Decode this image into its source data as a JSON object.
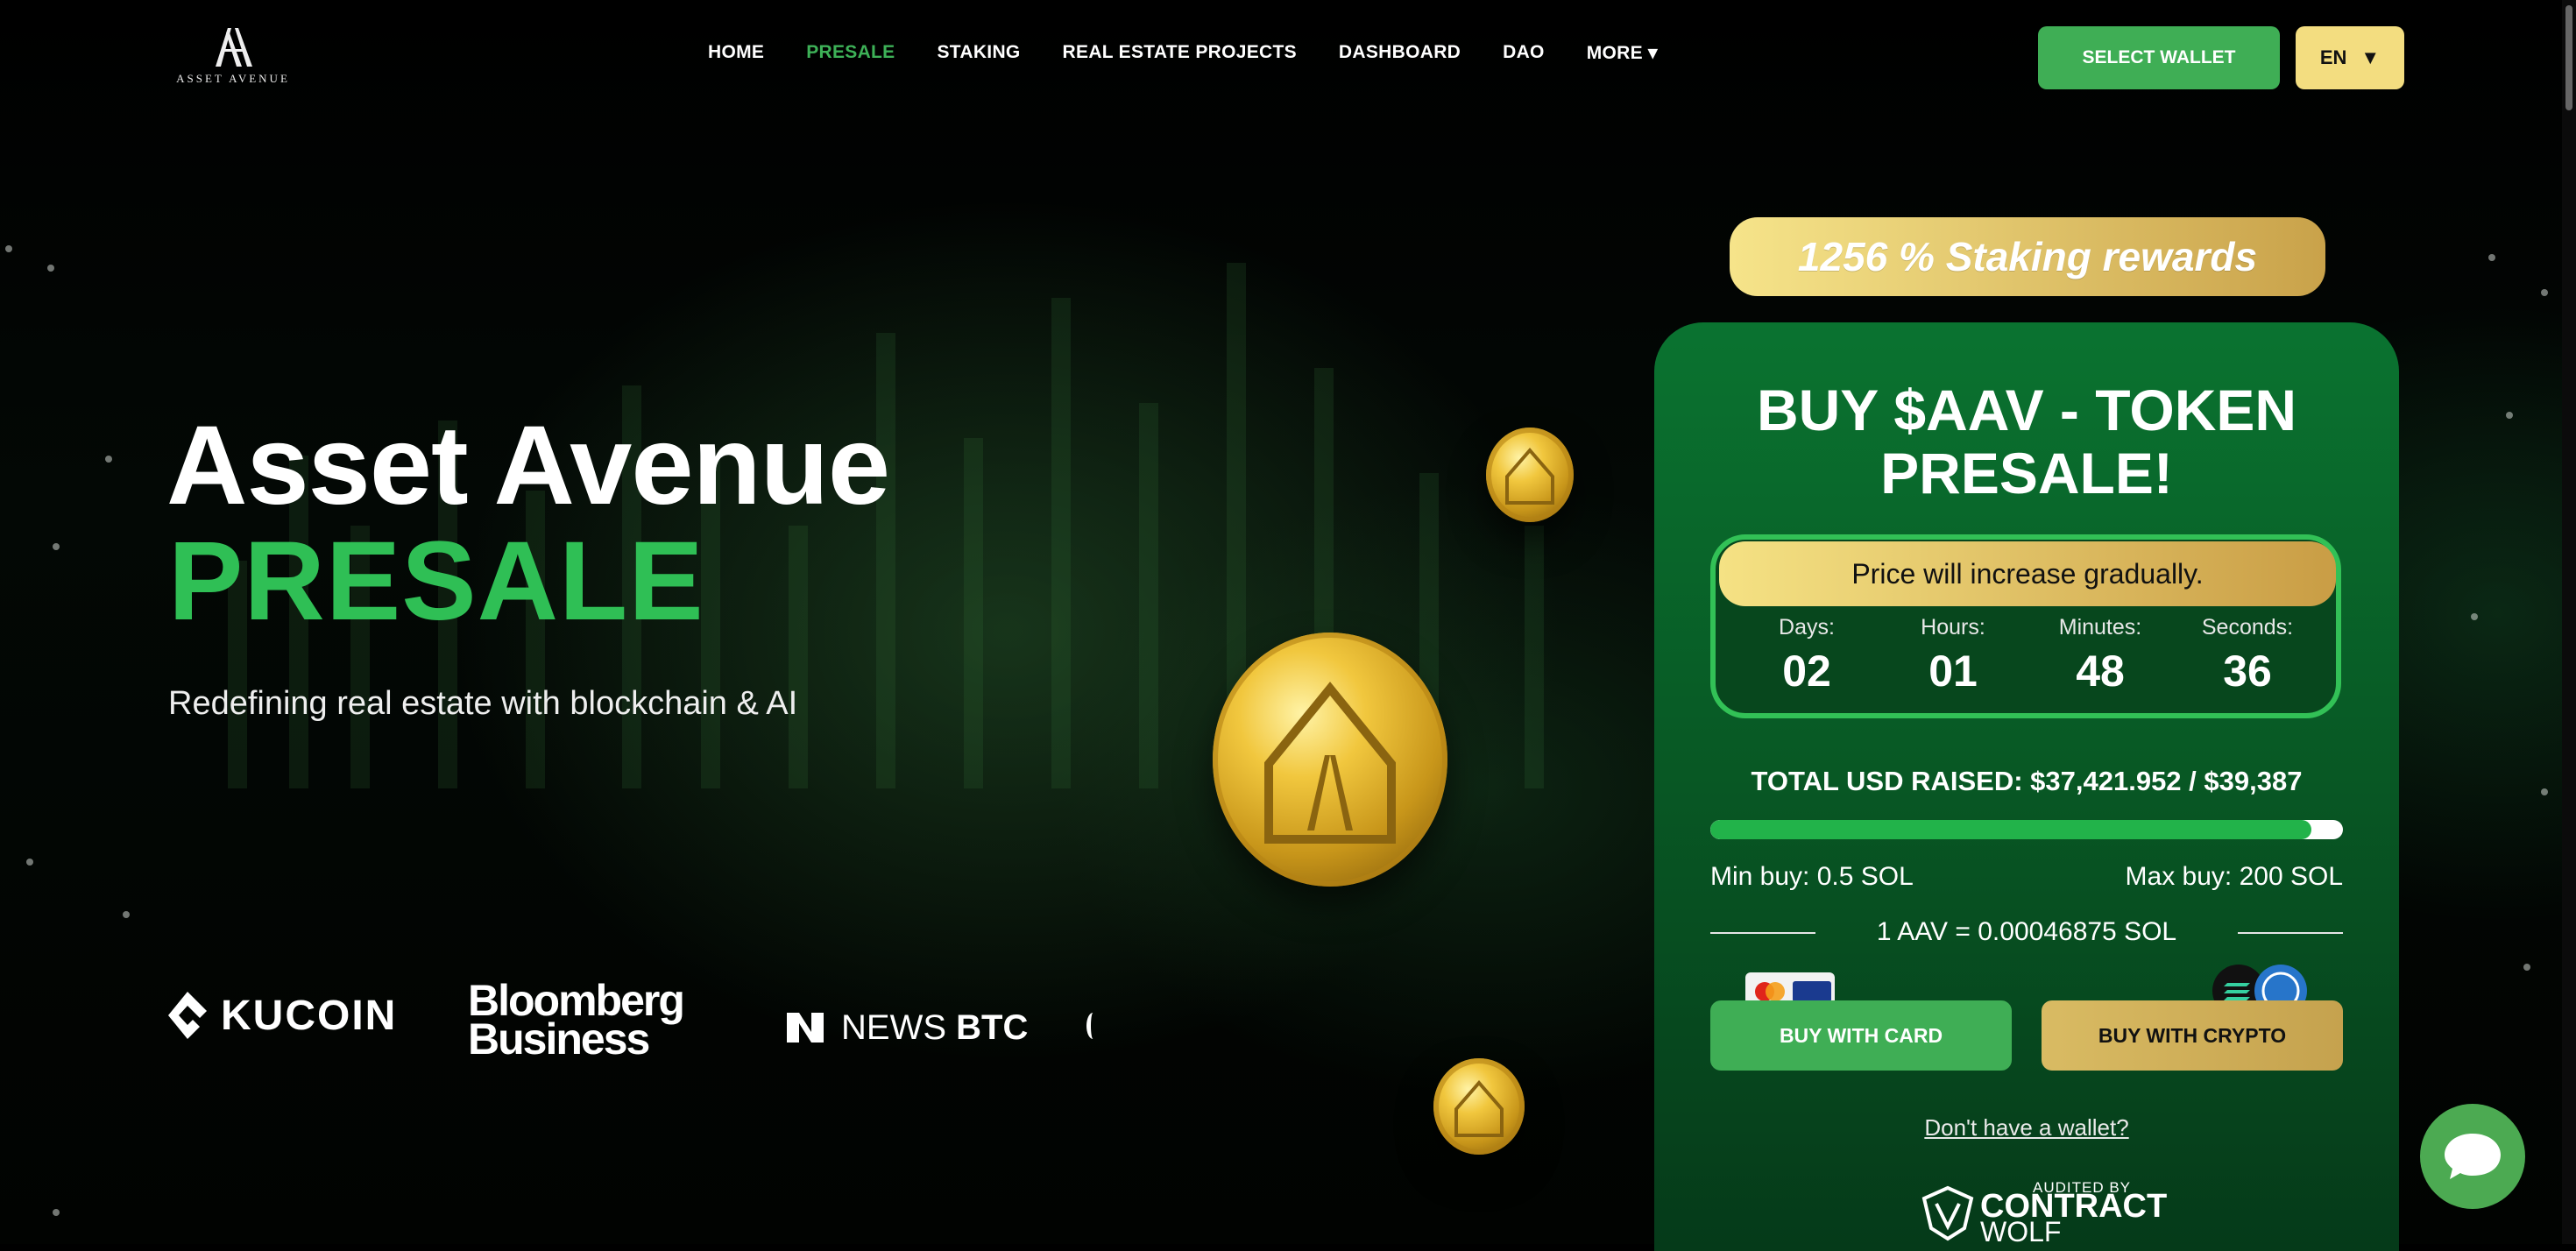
{
  "header": {
    "logo_text": "ASSET AVENUE",
    "nav": [
      "HOME",
      "PRESALE",
      "STAKING",
      "REAL ESTATE PROJECTS",
      "DASHBOARD",
      "DAO",
      "MORE ▾"
    ],
    "active_nav": "PRESALE",
    "select_wallet": "SELECT WALLET",
    "language": "EN",
    "language_caret": "▼"
  },
  "hero": {
    "title_line1": "Asset Avenue",
    "title_line2": "PRESALE",
    "subtitle": "Redefining real estate with blockchain & AI",
    "partners": {
      "kucoin": "KUCOIN",
      "bloomberg_line1": "Bloomberg",
      "bloomberg_line2": "Business",
      "newsbtc_a": "NEWS",
      "newsbtc_b": "BTC"
    }
  },
  "presale": {
    "staking_badge": "1256 % Staking rewards",
    "title": "BUY $AAV - TOKEN PRESALE!",
    "price_banner": "Price will increase gradually.",
    "timer": [
      {
        "label": "Days:",
        "value": "02"
      },
      {
        "label": "Hours:",
        "value": "01"
      },
      {
        "label": "Minutes:",
        "value": "48"
      },
      {
        "label": "Seconds:",
        "value": "36"
      }
    ],
    "raised_text": "TOTAL USD RAISED: $37,421.952 / $39,387",
    "raised_progress_pct": 95,
    "min_buy": "Min buy: 0.5 SOL",
    "max_buy": "Max buy: 200 SOL",
    "rate": "1 AAV = 0.00046875 SOL",
    "buy_card": "BUY WITH CARD",
    "buy_crypto": "BUY WITH CRYPTO",
    "no_wallet": "Don't have a wallet?",
    "audit_by": "AUDITED BY",
    "audit_name_1": "CONTRACT",
    "audit_name_2": "WOLF"
  },
  "colors": {
    "accent_green": "#3fae55",
    "presale_green": "#2fbf55",
    "gold": "#d9bb63",
    "background": "#000000"
  }
}
